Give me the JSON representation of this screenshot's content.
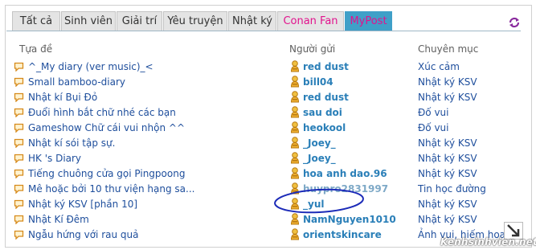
{
  "tabs": [
    {
      "label": "Tất cả"
    },
    {
      "label": "Sinh viên"
    },
    {
      "label": "Giải trí"
    },
    {
      "label": "Yêu truyện"
    },
    {
      "label": "Nhật ký"
    },
    {
      "label": "Conan Fan"
    },
    {
      "label": "MyPost"
    }
  ],
  "headers": {
    "title": "Tựa đề",
    "sender": "Người gửi",
    "category": "Chuyên mục"
  },
  "rows": [
    {
      "title": "^_My diary (ver music)_<",
      "user": "red dust",
      "category": "Xúc cảm"
    },
    {
      "title": "Small bamboo-diary",
      "user": "bill04",
      "category": "Nhật ký KSV"
    },
    {
      "title": "Nhật kí Bụi Đỏ",
      "user": "red dust",
      "category": "Nhật ký KSV"
    },
    {
      "title": "Đuổi hình bắt chữ nhé các bạn",
      "user": "sau doi",
      "category": "Đố vui"
    },
    {
      "title": "Gameshow Chữ cái vui nhộn ^^",
      "user": "heokool",
      "category": "Đố vui"
    },
    {
      "title": "Nhật kí sói tập sự.",
      "user": "_Joey_",
      "category": "Nhật ký KSV"
    },
    {
      "title": "HK 's Diary",
      "user": "_Joey_",
      "category": "Nhật ký KSV"
    },
    {
      "title": "Tiếng chuông cửa gọi Pingpoong",
      "user": "hoa anh dao.96",
      "category": "Nhật ký KSV"
    },
    {
      "title": "Mê hoặc bởi 10 thư viện hạng sa...",
      "user": "huypro2831997",
      "category": "Tin học đường"
    },
    {
      "title": "Nhật ký KSV [phần 10]",
      "user": "_yul",
      "category": "Nhật ký KSV"
    },
    {
      "title": "Nhật Kí Đêm",
      "user": "NamNguyen1010",
      "category": "Nhật ký KSV"
    },
    {
      "title": "Ngẫu hứng với rau quả",
      "user": "orientskincare",
      "category": "Ảnh vui, hiếm hoa"
    }
  ],
  "watermark": "Kenhsinhvien.net",
  "colors": {
    "accent": "#3fa0c8",
    "pink": "#e2128d",
    "link": "#1e4e9c",
    "user": "#2a7fb8",
    "circle": "#1c2bb8"
  },
  "icons": {
    "topic": "speech-bubble-icon",
    "user": "user-figure-icon",
    "refresh": "refresh-icon",
    "resize": "resize-arrow-icon"
  }
}
